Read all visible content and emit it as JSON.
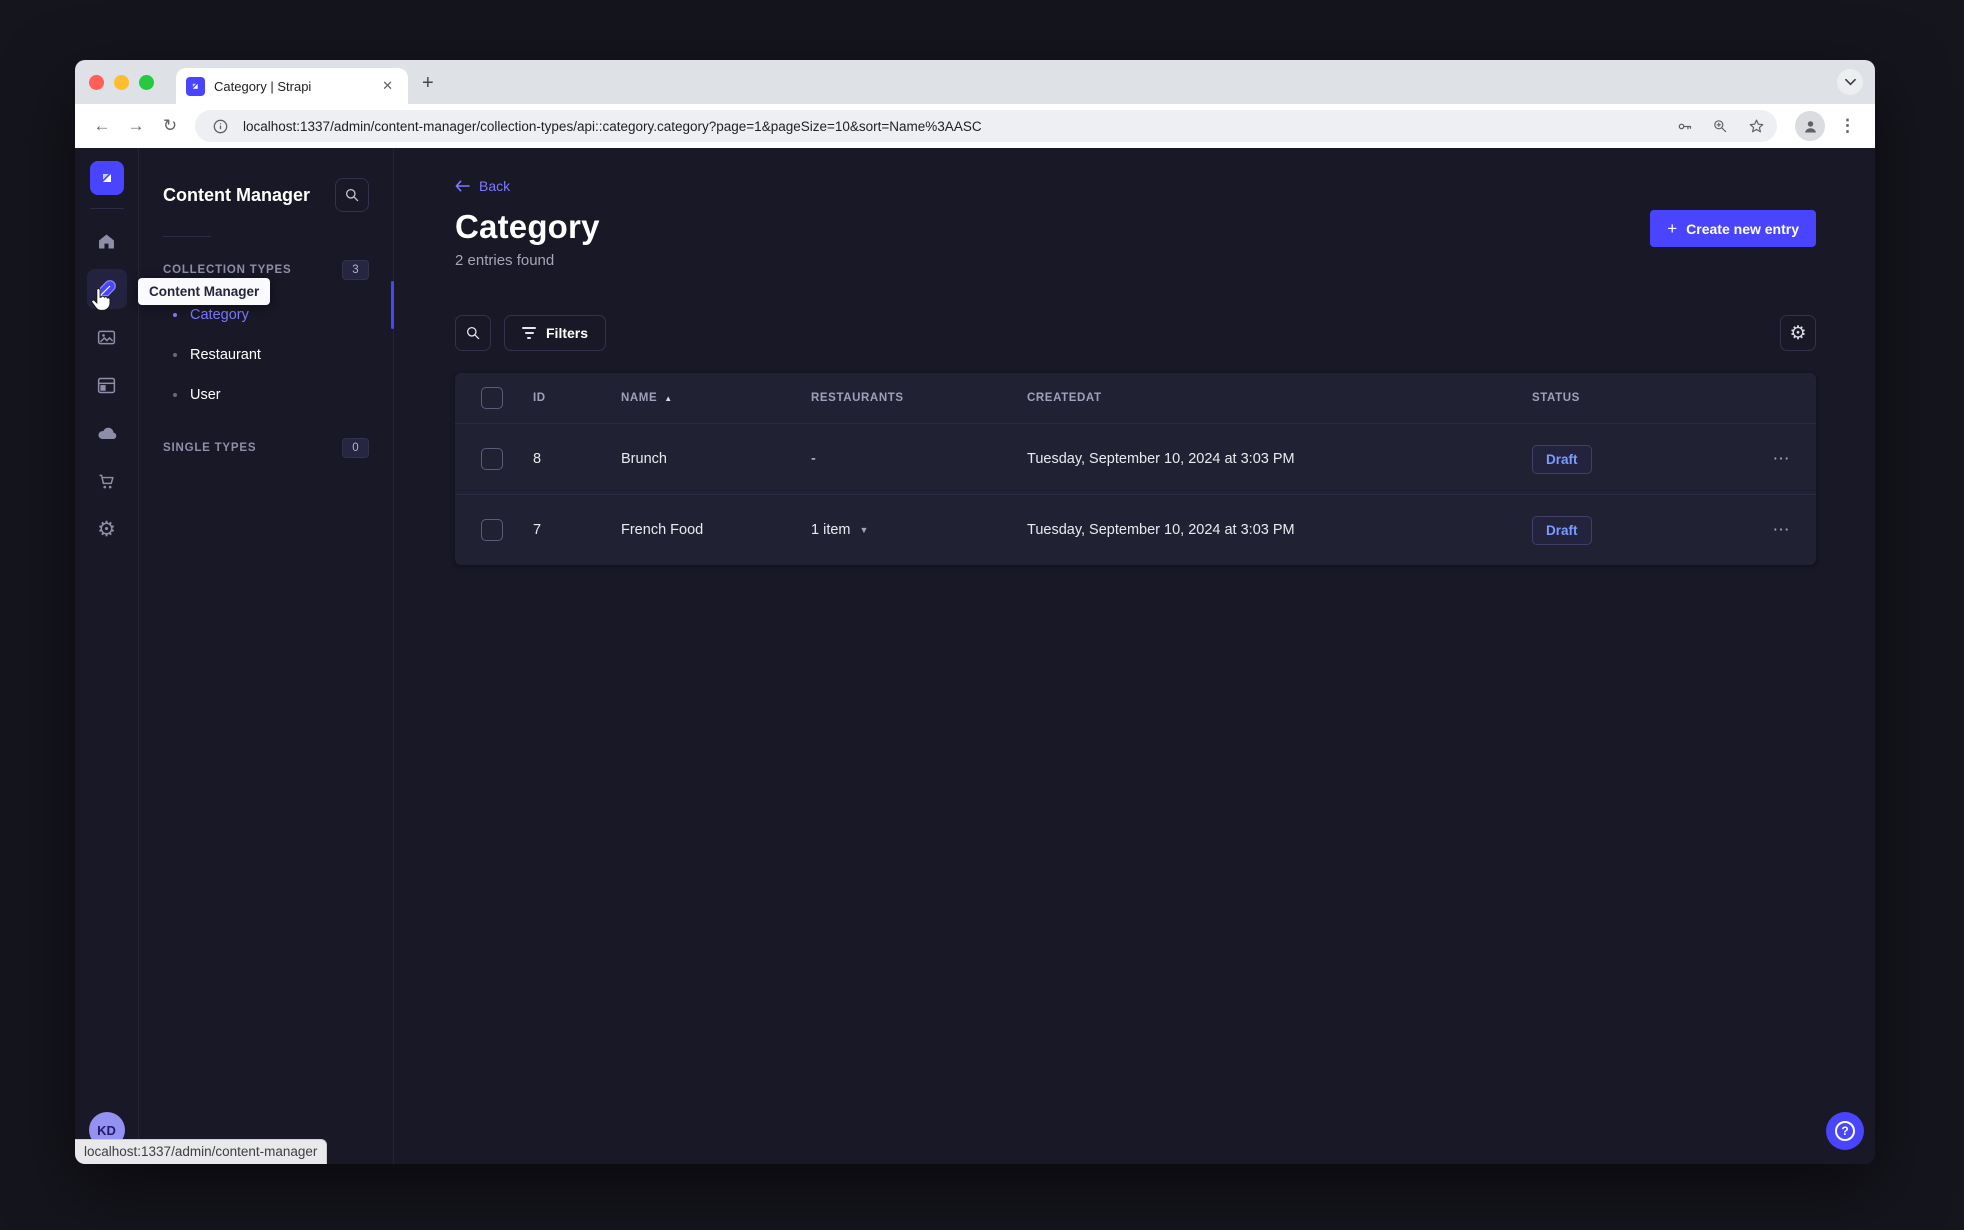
{
  "colors": {
    "accent": "#4945ff",
    "link_text": "#7b79ff",
    "draft_text": "#7b9dff",
    "traffic_red": "#ff5f57",
    "traffic_yellow": "#febc2e",
    "traffic_green": "#28c840"
  },
  "browser": {
    "tab_title": "Category | Strapi",
    "url": "localhost:1337/admin/content-manager/collection-types/api::category.category?page=1&pageSize=10&sort=Name%3AASC"
  },
  "nav_panel": {
    "title": "Content Manager",
    "tooltip": "Content Manager",
    "collection_types": {
      "label": "COLLECTION TYPES",
      "badge": "3",
      "items": [
        {
          "label": "Category"
        },
        {
          "label": "Restaurant"
        },
        {
          "label": "User"
        }
      ]
    },
    "single_types": {
      "label": "SINGLE TYPES",
      "badge": "0"
    }
  },
  "main": {
    "back_label": "Back",
    "title": "Category",
    "subtitle": "2 entries found",
    "create_button_label": "Create new entry",
    "filters_button_label": "Filters"
  },
  "table": {
    "headers": [
      "ID",
      "NAME",
      "RESTAURANTS",
      "CREATEDAT",
      "STATUS"
    ],
    "rows": [
      {
        "id": "8",
        "name": "Brunch",
        "restaurants": "-",
        "createdat": "Tuesday, September 10, 2024 at 3:03 PM",
        "status": "Draft"
      },
      {
        "id": "7",
        "name": "French Food",
        "restaurants": "1 item",
        "createdat": "Tuesday, September 10, 2024 at 3:03 PM",
        "status": "Draft"
      }
    ]
  },
  "footer": {
    "avatar_initials": "KD",
    "status_bar": "localhost:1337/admin/content-manager"
  }
}
